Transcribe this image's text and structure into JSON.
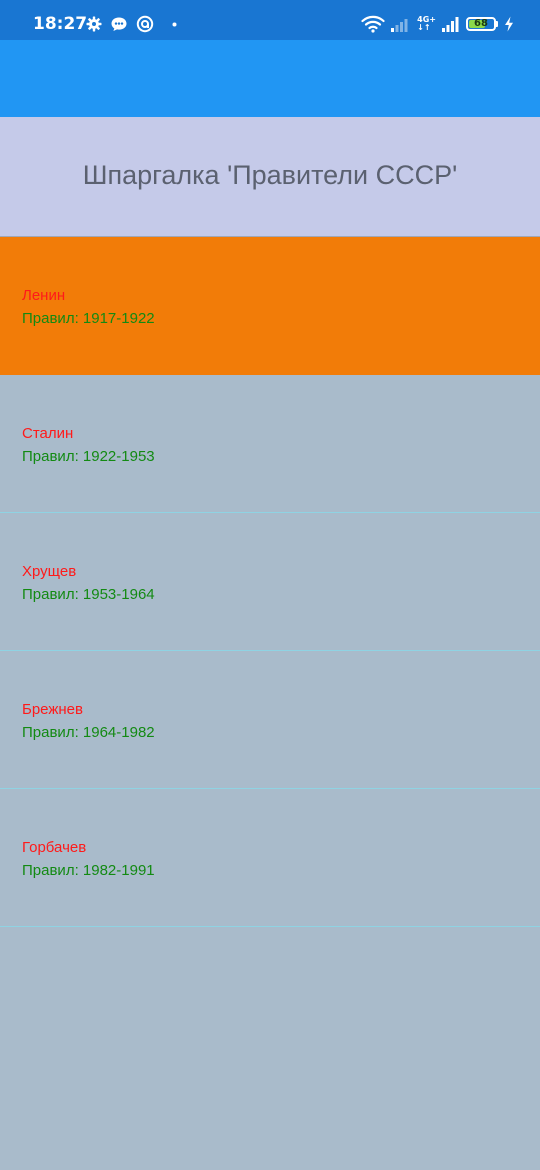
{
  "status_bar": {
    "time": "18:27",
    "network_top": "4G+",
    "network_bottom": "↓↑",
    "battery_level": "68",
    "battery_fraction": 0.68,
    "left_icons": [
      "gear-icon",
      "chat-bubble-icon",
      "circle-a-icon",
      "dot-icon"
    ],
    "right_icons": [
      "wifi-icon",
      "signal-bars-icon",
      "network-4g-icon",
      "signal-bars-icon",
      "battery-icon",
      "charging-bolt-icon"
    ]
  },
  "header": {
    "title": "Шпаргалка 'Правители СССР'"
  },
  "colors": {
    "status_bar": "#1976d2",
    "app_bar": "#2196f3",
    "title_panel": "#c5cae9",
    "selected_item": "#f27c08",
    "list_background": "#a9bbcb",
    "name_text": "#ff1a1a",
    "years_text": "#138a13",
    "divider": "#8fd3e3"
  },
  "rulers": [
    {
      "name": "Ленин",
      "years": "Правил: 1917-1922",
      "selected": true
    },
    {
      "name": "Сталин",
      "years": "Правил: 1922-1953",
      "selected": false
    },
    {
      "name": "Хрущев",
      "years": "Правил: 1953-1964",
      "selected": false
    },
    {
      "name": "Брежнев",
      "years": "Правил: 1964-1982",
      "selected": false
    },
    {
      "name": "Горбачев",
      "years": "Правил: 1982-1991",
      "selected": false
    }
  ]
}
